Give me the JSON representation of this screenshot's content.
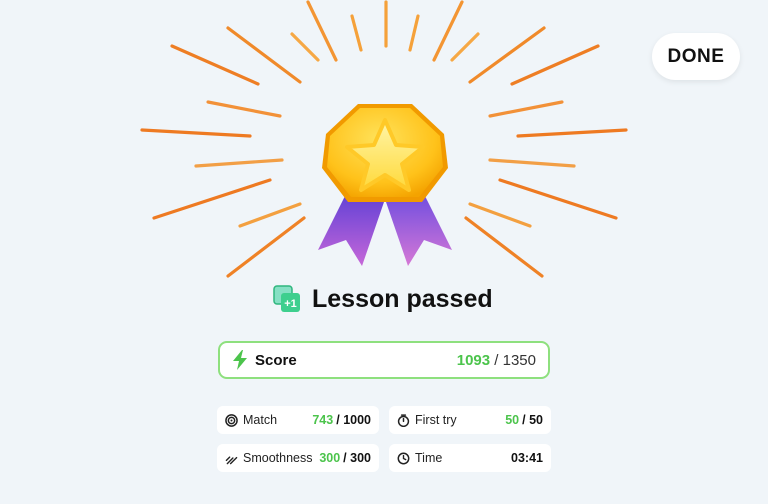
{
  "header": {
    "done_label": "DONE"
  },
  "result": {
    "title": "Lesson passed",
    "badge_text": "+1"
  },
  "score": {
    "label": "Score",
    "value": "1093",
    "separator": "/",
    "max": "1350"
  },
  "stats": [
    {
      "label": "Match",
      "value": "743",
      "separator": "/",
      "max": "1000",
      "icon": "target-icon"
    },
    {
      "label": "First try",
      "value": "50",
      "separator": "/",
      "max": "50",
      "icon": "stopwatch-icon"
    },
    {
      "label": "Smoothness",
      "value": "300",
      "separator": "/",
      "max": "300",
      "icon": "smoothness-icon"
    },
    {
      "label": "Time",
      "value": "03:41",
      "icon": "clock-icon"
    }
  ],
  "colors": {
    "accent_green": "#4cc44c",
    "border_green": "#8ee07e",
    "medal_gold": "#f7b500",
    "ribbon_purple": "#7a54e0",
    "ray_orange": "#f07a22"
  }
}
